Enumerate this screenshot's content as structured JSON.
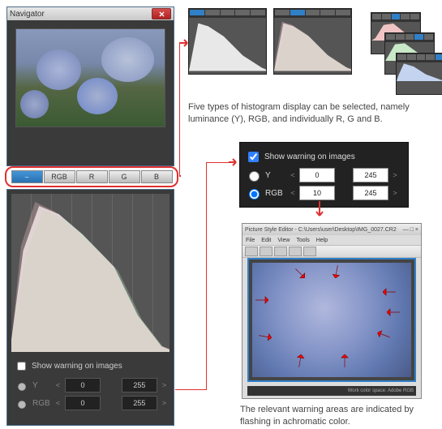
{
  "navigator": {
    "title": "Navigator",
    "histogram_tabs": [
      "⎯",
      "RGB",
      "R",
      "G",
      "B"
    ],
    "show_warning_label": "Show warning on images",
    "y_label": "Y",
    "rgb_label": "RGB",
    "y_low": "0",
    "y_high": "255",
    "rgb_low": "0",
    "rgb_high": "255"
  },
  "caption1": "Five types of histogram display can be selected, namely luminance (Y), RGB, and individually R, G and B.",
  "caption2": "The relevant warning areas are indicated by flashing in achromatic color.",
  "warning_panel": {
    "show_label": "Show warning on images",
    "y_label": "Y",
    "rgb_label": "RGB",
    "y_low": "0",
    "y_high": "245",
    "rgb_low": "10",
    "rgb_high": "245"
  },
  "editor": {
    "title": "Picture Style Editor - C:\\Users\\user\\Desktop\\IMG_0027.CR2",
    "menu": [
      "File",
      "Edit",
      "View",
      "Tools",
      "Help"
    ],
    "bottom_label": "Work color space: Adobe RGB",
    "win_controls": "— □ ×"
  },
  "chart_data": [
    {
      "type": "area",
      "name": "luminance-combined-large",
      "xlim": [
        0,
        255
      ],
      "ylim": [
        0,
        100
      ],
      "series": [
        {
          "name": "R",
          "color": "#f4b0b0"
        },
        {
          "name": "G",
          "color": "#b4e0b4"
        },
        {
          "name": "B",
          "color": "#b8c8f0"
        },
        {
          "name": "Y",
          "color": "#e8e8e8"
        }
      ],
      "x": [
        0,
        20,
        50,
        90,
        130,
        170,
        210,
        255
      ],
      "values_Y": [
        5,
        60,
        95,
        88,
        70,
        45,
        15,
        2
      ]
    },
    {
      "type": "area",
      "name": "thumb-Y",
      "xlim": [
        0,
        255
      ],
      "x": [
        0,
        50,
        100,
        180,
        255
      ],
      "values": [
        5,
        95,
        85,
        40,
        2
      ],
      "color": "#ddd"
    },
    {
      "type": "area",
      "name": "thumb-RGB",
      "xlim": [
        0,
        255
      ],
      "x": [
        0,
        50,
        100,
        180,
        255
      ],
      "values": [
        5,
        90,
        80,
        35,
        2
      ]
    },
    {
      "type": "area",
      "name": "thumb-R",
      "xlim": [
        0,
        255
      ],
      "x": [
        0,
        60,
        120,
        200,
        255
      ],
      "values": [
        2,
        40,
        85,
        30,
        2
      ],
      "color": "#f0c4c4"
    },
    {
      "type": "area",
      "name": "thumb-G",
      "xlim": [
        0,
        255
      ],
      "x": [
        0,
        50,
        110,
        190,
        255
      ],
      "values": [
        2,
        55,
        90,
        25,
        2
      ],
      "color": "#c8e8c8"
    },
    {
      "type": "area",
      "name": "thumb-B",
      "xlim": [
        0,
        255
      ],
      "x": [
        0,
        40,
        90,
        170,
        255
      ],
      "values": [
        5,
        95,
        70,
        20,
        2
      ],
      "color": "#c4d4f0"
    }
  ]
}
